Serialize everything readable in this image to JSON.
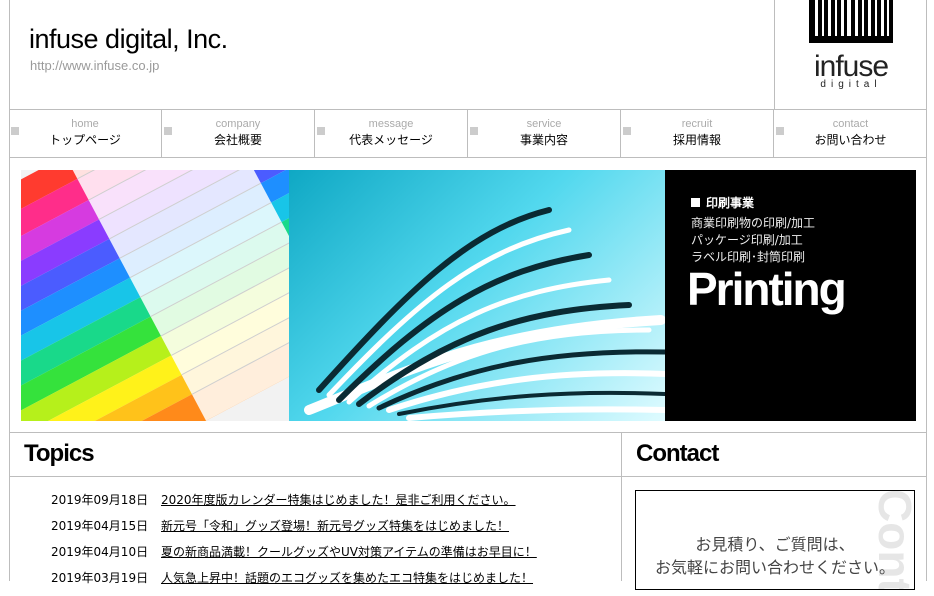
{
  "header": {
    "title": "infuse digital, Inc.",
    "url": "http://www.infuse.co.jp",
    "logo_word": "infuse",
    "logo_sub": "digital"
  },
  "nav": {
    "items": [
      {
        "en": "home",
        "ja": "トップページ"
      },
      {
        "en": "company",
        "ja": "会社概要"
      },
      {
        "en": "message",
        "ja": "代表メッセージ"
      },
      {
        "en": "service",
        "ja": "事業内容"
      },
      {
        "en": "recruit",
        "ja": "採用情報"
      },
      {
        "en": "contact",
        "ja": "お問い合わせ"
      }
    ]
  },
  "hero": {
    "heading": "印刷事業",
    "lines": [
      "商業印刷物の印刷/加工",
      "パッケージ印刷/加工",
      "ラベル印刷･封筒印刷"
    ],
    "big": "Printing"
  },
  "topics": {
    "title": "Topics",
    "items": [
      {
        "date": "2019年09月18日",
        "text": "2020年度版カレンダー特集はじめました！是非ご利用ください。"
      },
      {
        "date": "2019年04月15日",
        "text": "新元号「令和」グッズ登場！新元号グッズ特集をはじめました！"
      },
      {
        "date": "2019年04月10日",
        "text": "夏の新商品満載！クールグッズやUV対策アイテムの準備はお早目に！"
      },
      {
        "date": "2019年03月19日",
        "text": "人気急上昇中！話題のエコグッズを集めたエコ特集をはじめました！"
      }
    ]
  },
  "contact": {
    "title": "Contact",
    "line1": "お見積り、ご質問は、",
    "line2": "お気軽にお問い合わせください。",
    "watermark": "Cont"
  },
  "colors": {
    "accent": "#000000",
    "border": "#bdbdbd",
    "muted": "#9a9a9a"
  }
}
